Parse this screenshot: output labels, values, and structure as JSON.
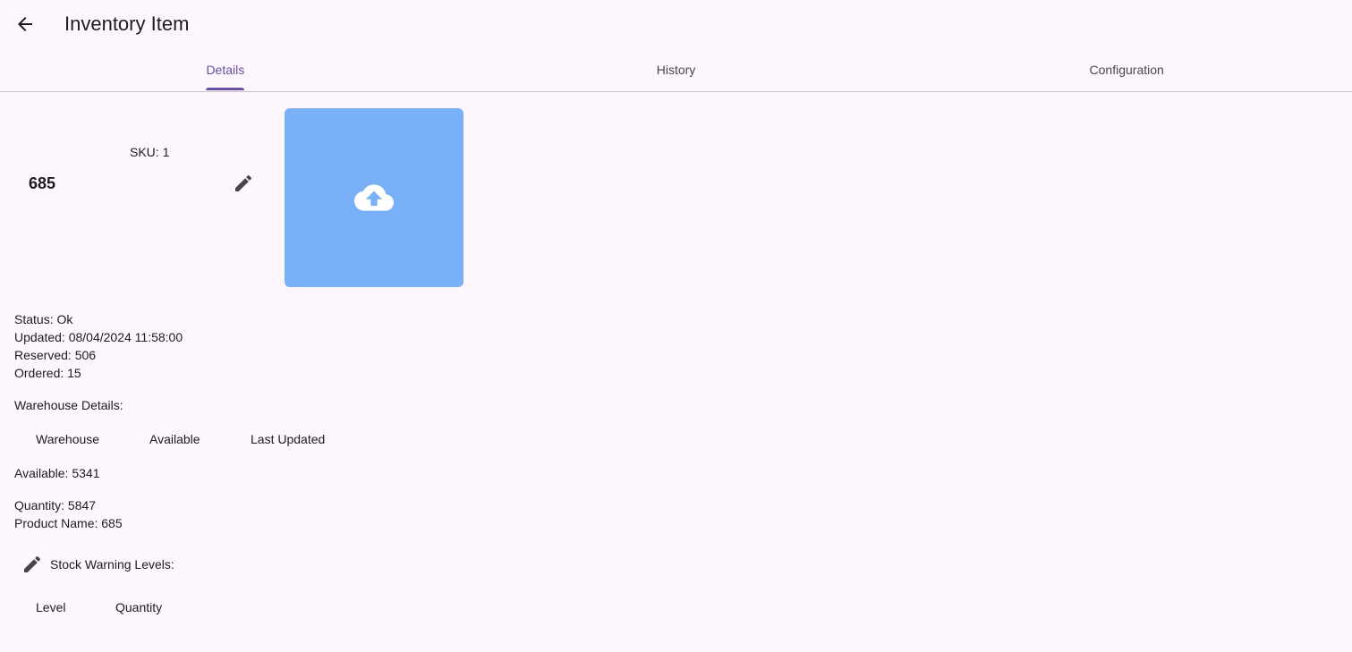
{
  "appbar": {
    "title": "Inventory Item",
    "back_icon": "arrow-back-icon"
  },
  "tabs": [
    {
      "label": "Details",
      "active": true
    },
    {
      "label": "History",
      "active": false
    },
    {
      "label": "Configuration",
      "active": false
    }
  ],
  "item": {
    "sku": "SKU: 1",
    "name": "685",
    "edit_icon": "pencil-icon",
    "upload_icon": "cloud-upload-icon"
  },
  "status": {
    "status": "Status: Ok",
    "updated": "Updated: 08/04/2024 11:58:00",
    "reserved": "Reserved: 506",
    "ordered": "Ordered: 15"
  },
  "warehouse": {
    "title": "Warehouse Details:",
    "columns": [
      "Warehouse",
      "Available",
      "Last Updated"
    ]
  },
  "available": "Available: 5341",
  "quantity": "Quantity: 5847",
  "product_name": "Product Name: 685",
  "stock_levels": {
    "title": "Stock Warning Levels:",
    "columns": [
      "Level",
      "Quantity"
    ]
  },
  "colors": {
    "primary": "#6750a4",
    "background": "#fdf7fd",
    "upload_box": "#7ab0f7",
    "divider": "#c9c4ce"
  }
}
